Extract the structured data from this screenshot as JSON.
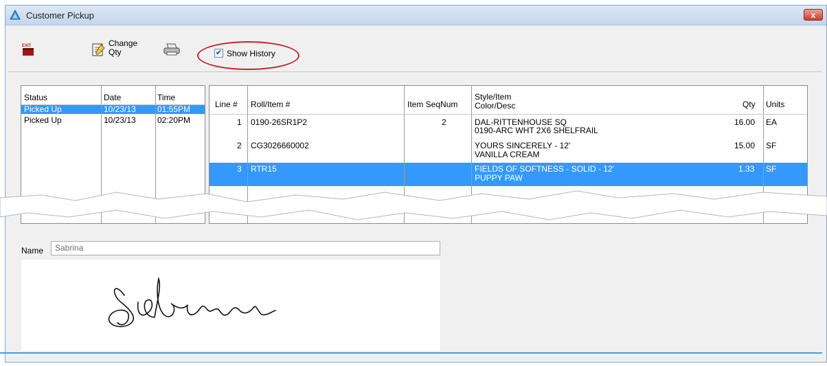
{
  "window": {
    "title": "Customer Pickup",
    "close_label": "x"
  },
  "toolbar": {
    "exit_label": "EXIT",
    "change_qty_line1": "Change",
    "change_qty_line2": "Qty",
    "show_history_label": "Show History",
    "show_history_checked": true
  },
  "status_grid": {
    "headers": {
      "status": "Status",
      "date": "Date",
      "time": "Time"
    },
    "rows": [
      {
        "status": "Picked Up",
        "date": "10/23/13",
        "time": "01:55PM",
        "selected": true
      },
      {
        "status": "Picked Up",
        "date": "10/23/13",
        "time": "02:20PM",
        "selected": false
      }
    ]
  },
  "lines_grid": {
    "headers": {
      "line": "Line #",
      "roll_item": "Roll/Item #",
      "item_seq": "Item SeqNum",
      "style_item": "Style/Item",
      "color_desc": "Color/Desc",
      "qty": "Qty",
      "units": "Units"
    },
    "rows": [
      {
        "line": "1",
        "roll_item": "0190-26SR1P2",
        "item_seq": "2",
        "style": "DAL-RITTENHOUSE SQ",
        "color": "0190-ARC WHT 2X6 SHELFRAIL",
        "qty": "16.00",
        "units": "EA",
        "selected": false
      },
      {
        "line": "2",
        "roll_item": "CG3026660002",
        "item_seq": "",
        "style": "YOURS SINCERELY - 12'",
        "color": "VANILLA CREAM",
        "qty": "15.00",
        "units": "SF",
        "selected": false
      },
      {
        "line": "3",
        "roll_item": "RTR15",
        "item_seq": "",
        "style": "FIELDS OF SOFTNESS - SOLID - 12'",
        "color": "PUPPY PAW",
        "qty": "1.33",
        "units": "SF",
        "selected": true
      }
    ]
  },
  "name": {
    "label": "Name",
    "value": "Sabrina"
  },
  "signature": {
    "text": "Sabrina"
  },
  "colors": {
    "selection": "#3399ff",
    "highlight_oval": "#c0282a",
    "accent_line": "#3fa0e0"
  }
}
